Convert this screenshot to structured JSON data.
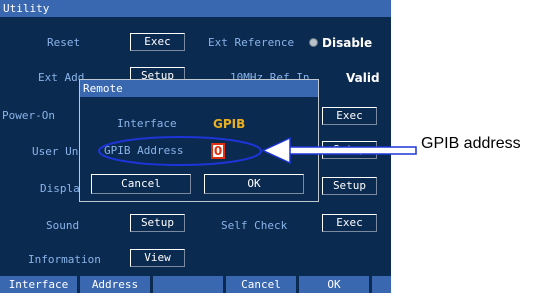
{
  "window": {
    "title": "Utility"
  },
  "rows": {
    "reset": {
      "label": "Reset",
      "button": "Exec"
    },
    "ext_reference": {
      "label": "Ext Reference",
      "value": "Disable"
    },
    "ext_add": {
      "label": "Ext Add",
      "button": "Setup"
    },
    "valid": {
      "label": "10MHz Ref In",
      "value": "Valid"
    },
    "power_on": {
      "label": "Power-On"
    },
    "power_on_exec": {
      "button": "Exec"
    },
    "user_unit": {
      "label": "User Unit",
      "button": "Setup"
    },
    "display": {
      "label": "Display",
      "button": "Setup"
    },
    "sound": {
      "label": "Sound",
      "button": "Setup"
    },
    "self_check": {
      "label": "Self Check",
      "button": "Exec"
    },
    "information": {
      "label": "Information",
      "button": "View"
    }
  },
  "dialog": {
    "title": "Remote",
    "interface_label": "Interface",
    "interface_value": "GPIB",
    "address_label": "GPIB Address",
    "address_value": "0",
    "cancel": "Cancel",
    "ok": "OK"
  },
  "softkeys": {
    "k1": "Interface",
    "k2": "Address",
    "k3": "",
    "k4": "Cancel",
    "k5": "OK",
    "k6": ""
  },
  "callout": {
    "text": "GPIB address"
  },
  "colors": {
    "screen": "#0b2a50",
    "titlebar": "#3a68b0",
    "label": "#8ab4ea",
    "highlight": "#e8b020",
    "accent_red": "#e03010",
    "callout_blue": "#1d35d8"
  }
}
